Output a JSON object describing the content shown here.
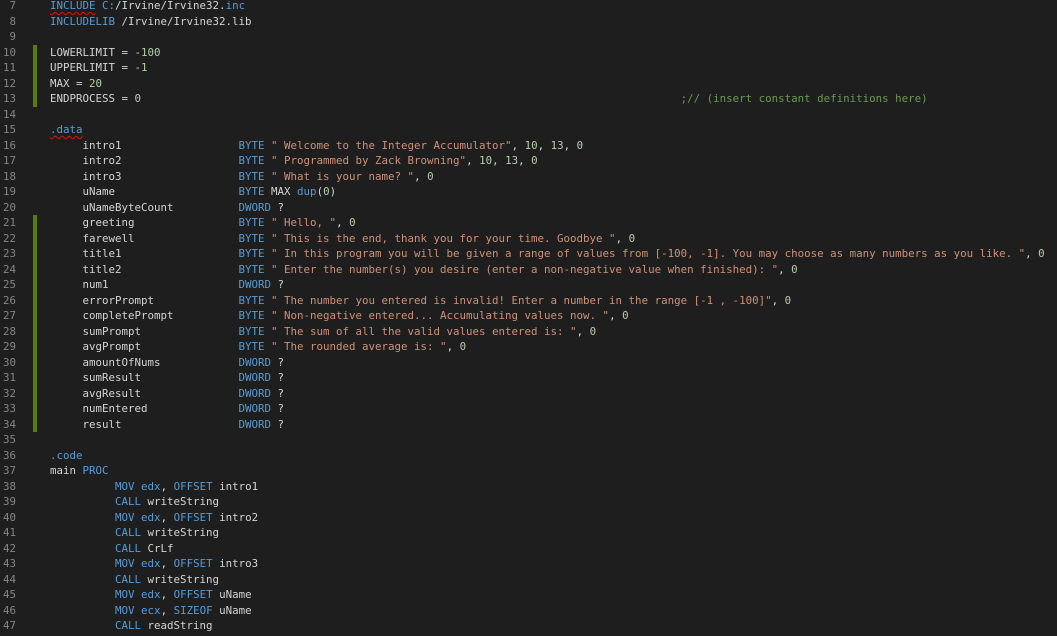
{
  "colors": {
    "background": "#1e1e1e",
    "line_number": "#858585",
    "keyword": "#569cd6",
    "string": "#ce9178",
    "number": "#b5cea8",
    "comment": "#6a9955",
    "text": "#d4d4d4",
    "modified_bar": "#587c0c"
  },
  "lines": [
    {
      "n": "7",
      "mod": false,
      "tokens": [
        [
          "kw",
          "INCLUDE",
          true
        ],
        [
          "plain",
          " "
        ],
        [
          "kw",
          "C:"
        ],
        [
          "plain",
          "/Irvine/Irvine32."
        ],
        [
          "kw",
          "inc"
        ]
      ]
    },
    {
      "n": "8",
      "mod": false,
      "tokens": [
        [
          "kw",
          "INCLUDELIB"
        ],
        [
          "plain",
          " /Irvine/Irvine32.lib"
        ]
      ]
    },
    {
      "n": "9",
      "mod": false,
      "tokens": []
    },
    {
      "n": "10",
      "mod": true,
      "tokens": [
        [
          "plain",
          "LOWERLIMIT = "
        ],
        [
          "num",
          "-100"
        ]
      ]
    },
    {
      "n": "11",
      "mod": true,
      "tokens": [
        [
          "plain",
          "UPPERLIMIT = "
        ],
        [
          "num",
          "-1"
        ]
      ]
    },
    {
      "n": "12",
      "mod": true,
      "tokens": [
        [
          "plain",
          "MAX = "
        ],
        [
          "num",
          "20"
        ]
      ]
    },
    {
      "n": "13",
      "mod": true,
      "tokens": [
        [
          "plain",
          "ENDPROCESS = "
        ],
        [
          "num",
          "0"
        ],
        [
          "plain",
          "                                                                                   "
        ],
        [
          "cmt",
          ";// (insert constant definitions here)"
        ]
      ]
    },
    {
      "n": "14",
      "mod": false,
      "tokens": []
    },
    {
      "n": "15",
      "mod": false,
      "tokens": [
        [
          "kw",
          ".data",
          true
        ]
      ]
    },
    {
      "n": "16",
      "mod": false,
      "tokens": [
        [
          "plain",
          "     intro1                  "
        ],
        [
          "kw",
          "BYTE"
        ],
        [
          "plain",
          " "
        ],
        [
          "str",
          "\" Welcome to the Integer Accumulator\""
        ],
        [
          "plain",
          ", "
        ],
        [
          "num",
          "10"
        ],
        [
          "plain",
          ", "
        ],
        [
          "num",
          "13"
        ],
        [
          "plain",
          ", "
        ],
        [
          "num",
          "0"
        ]
      ]
    },
    {
      "n": "17",
      "mod": false,
      "tokens": [
        [
          "plain",
          "     intro2                  "
        ],
        [
          "kw",
          "BYTE"
        ],
        [
          "plain",
          " "
        ],
        [
          "str",
          "\" Programmed by Zack Browning\""
        ],
        [
          "plain",
          ", "
        ],
        [
          "num",
          "10"
        ],
        [
          "plain",
          ", "
        ],
        [
          "num",
          "13"
        ],
        [
          "plain",
          ", "
        ],
        [
          "num",
          "0"
        ]
      ]
    },
    {
      "n": "18",
      "mod": false,
      "tokens": [
        [
          "plain",
          "     intro3                  "
        ],
        [
          "kw",
          "BYTE"
        ],
        [
          "plain",
          " "
        ],
        [
          "str",
          "\" What is your name? \""
        ],
        [
          "plain",
          ", "
        ],
        [
          "num",
          "0"
        ]
      ]
    },
    {
      "n": "19",
      "mod": false,
      "tokens": [
        [
          "plain",
          "     uName                   "
        ],
        [
          "kw",
          "BYTE"
        ],
        [
          "plain",
          " MAX "
        ],
        [
          "kw",
          "dup"
        ],
        [
          "plain",
          "("
        ],
        [
          "num",
          "0"
        ],
        [
          "plain",
          ")"
        ]
      ]
    },
    {
      "n": "20",
      "mod": false,
      "tokens": [
        [
          "plain",
          "     uNameByteCount          "
        ],
        [
          "kw",
          "DWORD"
        ],
        [
          "plain",
          " ?"
        ]
      ]
    },
    {
      "n": "21",
      "mod": true,
      "tokens": [
        [
          "plain",
          "     greeting                "
        ],
        [
          "kw",
          "BYTE"
        ],
        [
          "plain",
          " "
        ],
        [
          "str",
          "\" Hello, \""
        ],
        [
          "plain",
          ", "
        ],
        [
          "num",
          "0"
        ]
      ]
    },
    {
      "n": "22",
      "mod": true,
      "tokens": [
        [
          "plain",
          "     farewell                "
        ],
        [
          "kw",
          "BYTE"
        ],
        [
          "plain",
          " "
        ],
        [
          "str",
          "\" This is the end, thank you for your time. Goodbye \""
        ],
        [
          "plain",
          ", "
        ],
        [
          "num",
          "0"
        ]
      ]
    },
    {
      "n": "23",
      "mod": true,
      "tokens": [
        [
          "plain",
          "     title1                  "
        ],
        [
          "kw",
          "BYTE"
        ],
        [
          "plain",
          " "
        ],
        [
          "str",
          "\" In this program you will be given a range of values from [-100, -1]. You may choose as many numbers as you like. \""
        ],
        [
          "plain",
          ", "
        ],
        [
          "num",
          "0"
        ]
      ]
    },
    {
      "n": "24",
      "mod": true,
      "tokens": [
        [
          "plain",
          "     title2                  "
        ],
        [
          "kw",
          "BYTE"
        ],
        [
          "plain",
          " "
        ],
        [
          "str",
          "\" Enter the number(s) you desire (enter a non-negative value when finished): \""
        ],
        [
          "plain",
          ", "
        ],
        [
          "num",
          "0"
        ]
      ]
    },
    {
      "n": "25",
      "mod": true,
      "tokens": [
        [
          "plain",
          "     num1                    "
        ],
        [
          "kw",
          "DWORD"
        ],
        [
          "plain",
          " ?"
        ]
      ]
    },
    {
      "n": "26",
      "mod": true,
      "tokens": [
        [
          "plain",
          "     errorPrompt             "
        ],
        [
          "kw",
          "BYTE"
        ],
        [
          "plain",
          " "
        ],
        [
          "str",
          "\" The number you entered is invalid! Enter a number in the range [-1 , -100]\""
        ],
        [
          "plain",
          ", "
        ],
        [
          "num",
          "0"
        ]
      ]
    },
    {
      "n": "27",
      "mod": true,
      "tokens": [
        [
          "plain",
          "     completePrompt          "
        ],
        [
          "kw",
          "BYTE"
        ],
        [
          "plain",
          " "
        ],
        [
          "str",
          "\" Non-negative entered... Accumulating values now. \""
        ],
        [
          "plain",
          ", "
        ],
        [
          "num",
          "0"
        ]
      ]
    },
    {
      "n": "28",
      "mod": true,
      "tokens": [
        [
          "plain",
          "     sumPrompt               "
        ],
        [
          "kw",
          "BYTE"
        ],
        [
          "plain",
          " "
        ],
        [
          "str",
          "\" The sum of all the valid values entered is: \""
        ],
        [
          "plain",
          ", "
        ],
        [
          "num",
          "0"
        ]
      ]
    },
    {
      "n": "29",
      "mod": true,
      "tokens": [
        [
          "plain",
          "     avgPrompt               "
        ],
        [
          "kw",
          "BYTE"
        ],
        [
          "plain",
          " "
        ],
        [
          "str",
          "\" The rounded average is: \""
        ],
        [
          "plain",
          ", "
        ],
        [
          "num",
          "0"
        ]
      ]
    },
    {
      "n": "30",
      "mod": true,
      "tokens": [
        [
          "plain",
          "     amountOfNums            "
        ],
        [
          "kw",
          "DWORD"
        ],
        [
          "plain",
          " ?"
        ]
      ]
    },
    {
      "n": "31",
      "mod": true,
      "tokens": [
        [
          "plain",
          "     sumResult               "
        ],
        [
          "kw",
          "DWORD"
        ],
        [
          "plain",
          " ?"
        ]
      ]
    },
    {
      "n": "32",
      "mod": true,
      "tokens": [
        [
          "plain",
          "     avgResult               "
        ],
        [
          "kw",
          "DWORD"
        ],
        [
          "plain",
          " ?"
        ]
      ]
    },
    {
      "n": "33",
      "mod": true,
      "tokens": [
        [
          "plain",
          "     numEntered              "
        ],
        [
          "kw",
          "DWORD"
        ],
        [
          "plain",
          " ?"
        ]
      ]
    },
    {
      "n": "34",
      "mod": true,
      "tokens": [
        [
          "plain",
          "     result                  "
        ],
        [
          "kw",
          "DWORD"
        ],
        [
          "plain",
          " ?"
        ]
      ]
    },
    {
      "n": "35",
      "mod": false,
      "tokens": []
    },
    {
      "n": "36",
      "mod": false,
      "tokens": [
        [
          "kw",
          ".code"
        ]
      ]
    },
    {
      "n": "37",
      "mod": false,
      "tokens": [
        [
          "plain",
          "main "
        ],
        [
          "kw",
          "PROC"
        ]
      ]
    },
    {
      "n": "38",
      "mod": false,
      "tokens": [
        [
          "plain",
          "          "
        ],
        [
          "kw",
          "MOV"
        ],
        [
          "plain",
          " "
        ],
        [
          "kw",
          "edx"
        ],
        [
          "plain",
          ", "
        ],
        [
          "kw",
          "OFFSET"
        ],
        [
          "plain",
          " intro1"
        ]
      ]
    },
    {
      "n": "39",
      "mod": false,
      "tokens": [
        [
          "plain",
          "          "
        ],
        [
          "kw",
          "CALL"
        ],
        [
          "plain",
          " writeString"
        ]
      ]
    },
    {
      "n": "40",
      "mod": false,
      "tokens": [
        [
          "plain",
          "          "
        ],
        [
          "kw",
          "MOV"
        ],
        [
          "plain",
          " "
        ],
        [
          "kw",
          "edx"
        ],
        [
          "plain",
          ", "
        ],
        [
          "kw",
          "OFFSET"
        ],
        [
          "plain",
          " intro2"
        ]
      ]
    },
    {
      "n": "41",
      "mod": false,
      "tokens": [
        [
          "plain",
          "          "
        ],
        [
          "kw",
          "CALL"
        ],
        [
          "plain",
          " writeString"
        ]
      ]
    },
    {
      "n": "42",
      "mod": false,
      "tokens": [
        [
          "plain",
          "          "
        ],
        [
          "kw",
          "CALL"
        ],
        [
          "plain",
          " CrLf"
        ]
      ]
    },
    {
      "n": "43",
      "mod": false,
      "tokens": [
        [
          "plain",
          "          "
        ],
        [
          "kw",
          "MOV"
        ],
        [
          "plain",
          " "
        ],
        [
          "kw",
          "edx"
        ],
        [
          "plain",
          ", "
        ],
        [
          "kw",
          "OFFSET"
        ],
        [
          "plain",
          " intro3"
        ]
      ]
    },
    {
      "n": "44",
      "mod": false,
      "tokens": [
        [
          "plain",
          "          "
        ],
        [
          "kw",
          "CALL"
        ],
        [
          "plain",
          " writeString"
        ]
      ]
    },
    {
      "n": "45",
      "mod": false,
      "tokens": [
        [
          "plain",
          "          "
        ],
        [
          "kw",
          "MOV"
        ],
        [
          "plain",
          " "
        ],
        [
          "kw",
          "edx"
        ],
        [
          "plain",
          ", "
        ],
        [
          "kw",
          "OFFSET"
        ],
        [
          "plain",
          " uName"
        ]
      ]
    },
    {
      "n": "46",
      "mod": false,
      "tokens": [
        [
          "plain",
          "          "
        ],
        [
          "kw",
          "MOV"
        ],
        [
          "plain",
          " "
        ],
        [
          "kw",
          "ecx"
        ],
        [
          "plain",
          ", "
        ],
        [
          "kw",
          "SIZEOF"
        ],
        [
          "plain",
          " uName"
        ]
      ]
    },
    {
      "n": "47",
      "mod": false,
      "tokens": [
        [
          "plain",
          "          "
        ],
        [
          "kw",
          "CALL"
        ],
        [
          "plain",
          " readString"
        ]
      ]
    }
  ]
}
